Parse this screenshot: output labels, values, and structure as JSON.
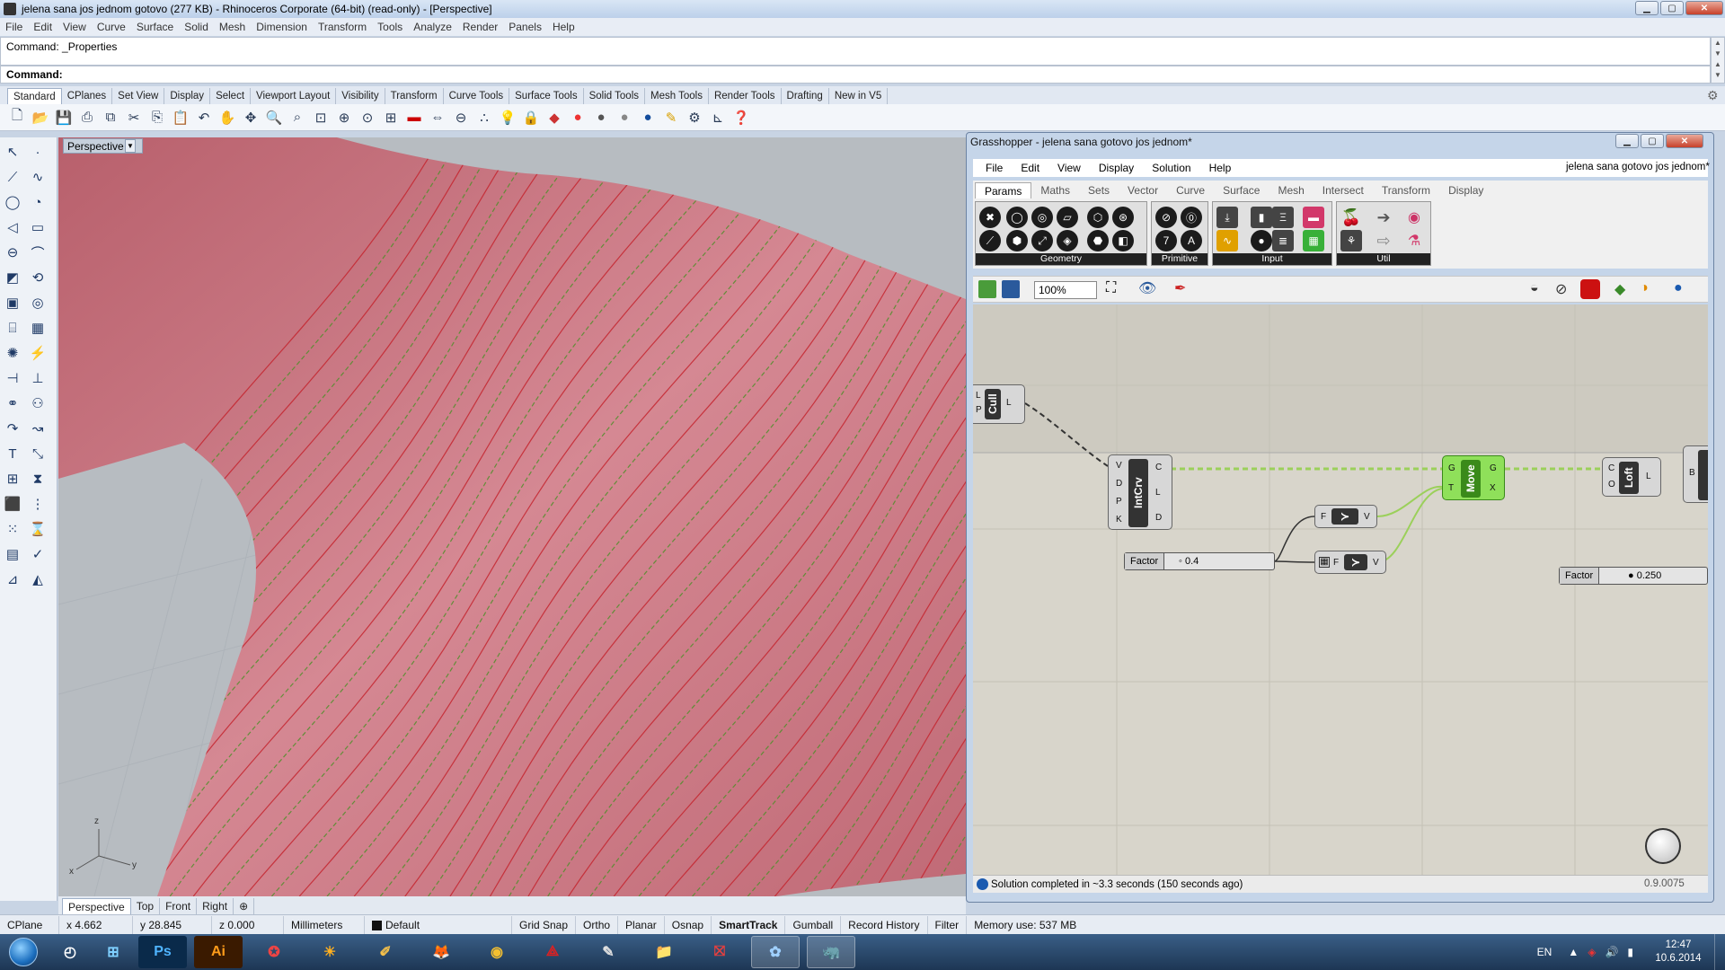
{
  "window": {
    "title": "jelena sana jos jednom gotovo (277 KB) - Rhinoceros Corporate (64-bit) (read-only) - [Perspective]"
  },
  "menu": [
    "File",
    "Edit",
    "View",
    "Curve",
    "Surface",
    "Solid",
    "Mesh",
    "Dimension",
    "Transform",
    "Tools",
    "Analyze",
    "Render",
    "Panels",
    "Help"
  ],
  "command": {
    "history": "Command: _Properties",
    "prompt": "Command:"
  },
  "toolbar_tabs": [
    "Standard",
    "CPlanes",
    "Set View",
    "Display",
    "Select",
    "Viewport Layout",
    "Visibility",
    "Transform",
    "Curve Tools",
    "Surface Tools",
    "Solid Tools",
    "Mesh Tools",
    "Render Tools",
    "Drafting",
    "New in V5"
  ],
  "viewport": {
    "name": "Perspective",
    "tabs": [
      "Perspective",
      "Top",
      "Front",
      "Right"
    ],
    "axis_x": "x",
    "axis_y": "y",
    "axis_z": "z"
  },
  "statusbar": {
    "cplane": "CPlane",
    "x": "x 4.662",
    "y": "y 28.845",
    "z": "z 0.000",
    "units": "Millimeters",
    "layer": "Default",
    "grid_snap": "Grid Snap",
    "ortho": "Ortho",
    "planar": "Planar",
    "osnap": "Osnap",
    "smarttrack": "SmartTrack",
    "gumball": "Gumball",
    "record_history": "Record History",
    "filter": "Filter",
    "memory": "Memory use: 537 MB"
  },
  "grasshopper": {
    "title": "Grasshopper - jelena sana gotovo jos jednom*",
    "menu": [
      "File",
      "Edit",
      "View",
      "Display",
      "Solution",
      "Help"
    ],
    "doc_name": "jelena sana gotovo jos jednom*",
    "tabs": [
      "Params",
      "Maths",
      "Sets",
      "Vector",
      "Curve",
      "Surface",
      "Mesh",
      "Intersect",
      "Transform",
      "Display"
    ],
    "groups": [
      "Geometry",
      "Primitive",
      "Input",
      "Util"
    ],
    "zoom": "100%",
    "nodes": {
      "cull": {
        "label": "Cull",
        "in": [
          "L",
          "P"
        ],
        "out": [
          "L"
        ]
      },
      "intcrv": {
        "label": "IntCrv",
        "in": [
          "V",
          "D",
          "P",
          "K"
        ],
        "out": [
          "C",
          "L",
          "D"
        ]
      },
      "move": {
        "label": "Move",
        "in": [
          "G",
          "T"
        ],
        "out": [
          "G",
          "X"
        ]
      },
      "loft": {
        "label": "Loft",
        "in": [
          "C",
          "O"
        ],
        "out": [
          "L"
        ]
      },
      "amp1": {
        "in": "F",
        "out": "V"
      },
      "amp2": {
        "in": "F",
        "out": "V"
      },
      "b": "B"
    },
    "sliders": [
      {
        "label": "Factor",
        "value": "0.4"
      },
      {
        "label": "Factor",
        "value": "0.250"
      }
    ],
    "status": "Solution completed in ~3.3 seconds (150 seconds ago)",
    "version": "0.9.0075"
  },
  "taskbar": {
    "apps": [
      "Ps",
      "Ai"
    ],
    "lang": "EN",
    "time": "12:47",
    "date": "10.6.2014"
  },
  "colors": {
    "surface": "#c86a78",
    "curve_red": "#c4242e",
    "curve_green": "#4f8f2a",
    "gh_active": "#6fd23a"
  }
}
